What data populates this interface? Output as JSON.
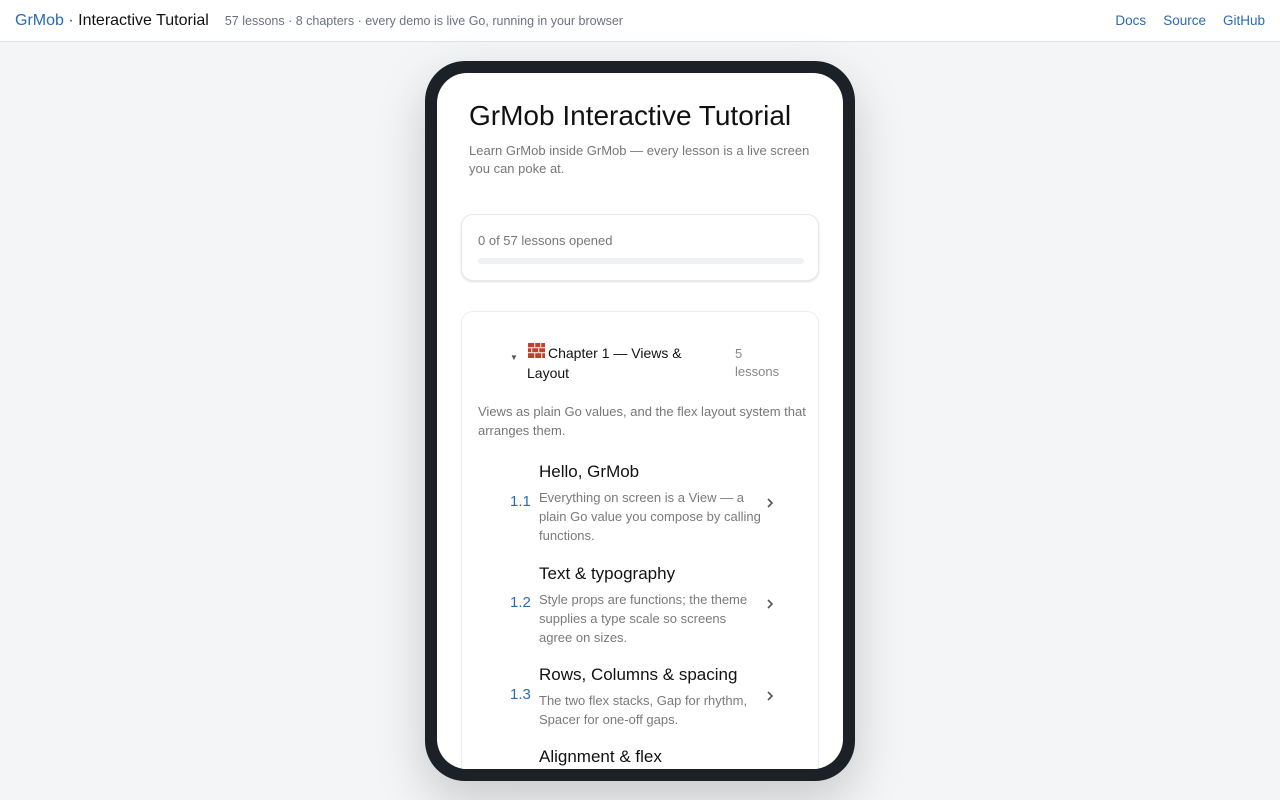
{
  "header": {
    "brand_link": "GrMob",
    "brand_sep": " · ",
    "brand_rest": "Interactive Tutorial",
    "tagline": "57 lessons · 8 chapters · every demo is live Go, running in your browser",
    "nav": [
      "Docs",
      "Source",
      "GitHub"
    ]
  },
  "app": {
    "title": "GrMob Interactive Tutorial",
    "subtitle": "Learn GrMob inside GrMob — every lesson is a live screen you can poke at."
  },
  "progress": {
    "text": "0 of 57 lessons opened",
    "opened": 0,
    "total": 57,
    "fill_color": "#2b6cb0"
  },
  "chapter": {
    "emoji_icon": "brick-icon",
    "title": "Chapter 1 — Views & Layout",
    "count": "5 lessons",
    "description": "Views as plain Go values, and the flex layout system that arranges them.",
    "lessons": [
      {
        "num": "1.1",
        "title": "Hello, GrMob",
        "desc": "Everything on screen is a View — a plain Go value you compose by calling functions."
      },
      {
        "num": "1.2",
        "title": "Text & typography",
        "desc": "Style props are functions; the theme supplies a type scale so screens agree on sizes."
      },
      {
        "num": "1.3",
        "title": "Rows, Columns & spacing",
        "desc": "The two flex stacks, Gap for rhythm, Spacer for one-off gaps."
      },
      {
        "num": "",
        "title": "Alignment & flex",
        "desc": ""
      }
    ]
  },
  "colors": {
    "accent": "#2b6cb0",
    "phone_frame": "#1c2128",
    "page_bg": "#f3f5f7"
  }
}
